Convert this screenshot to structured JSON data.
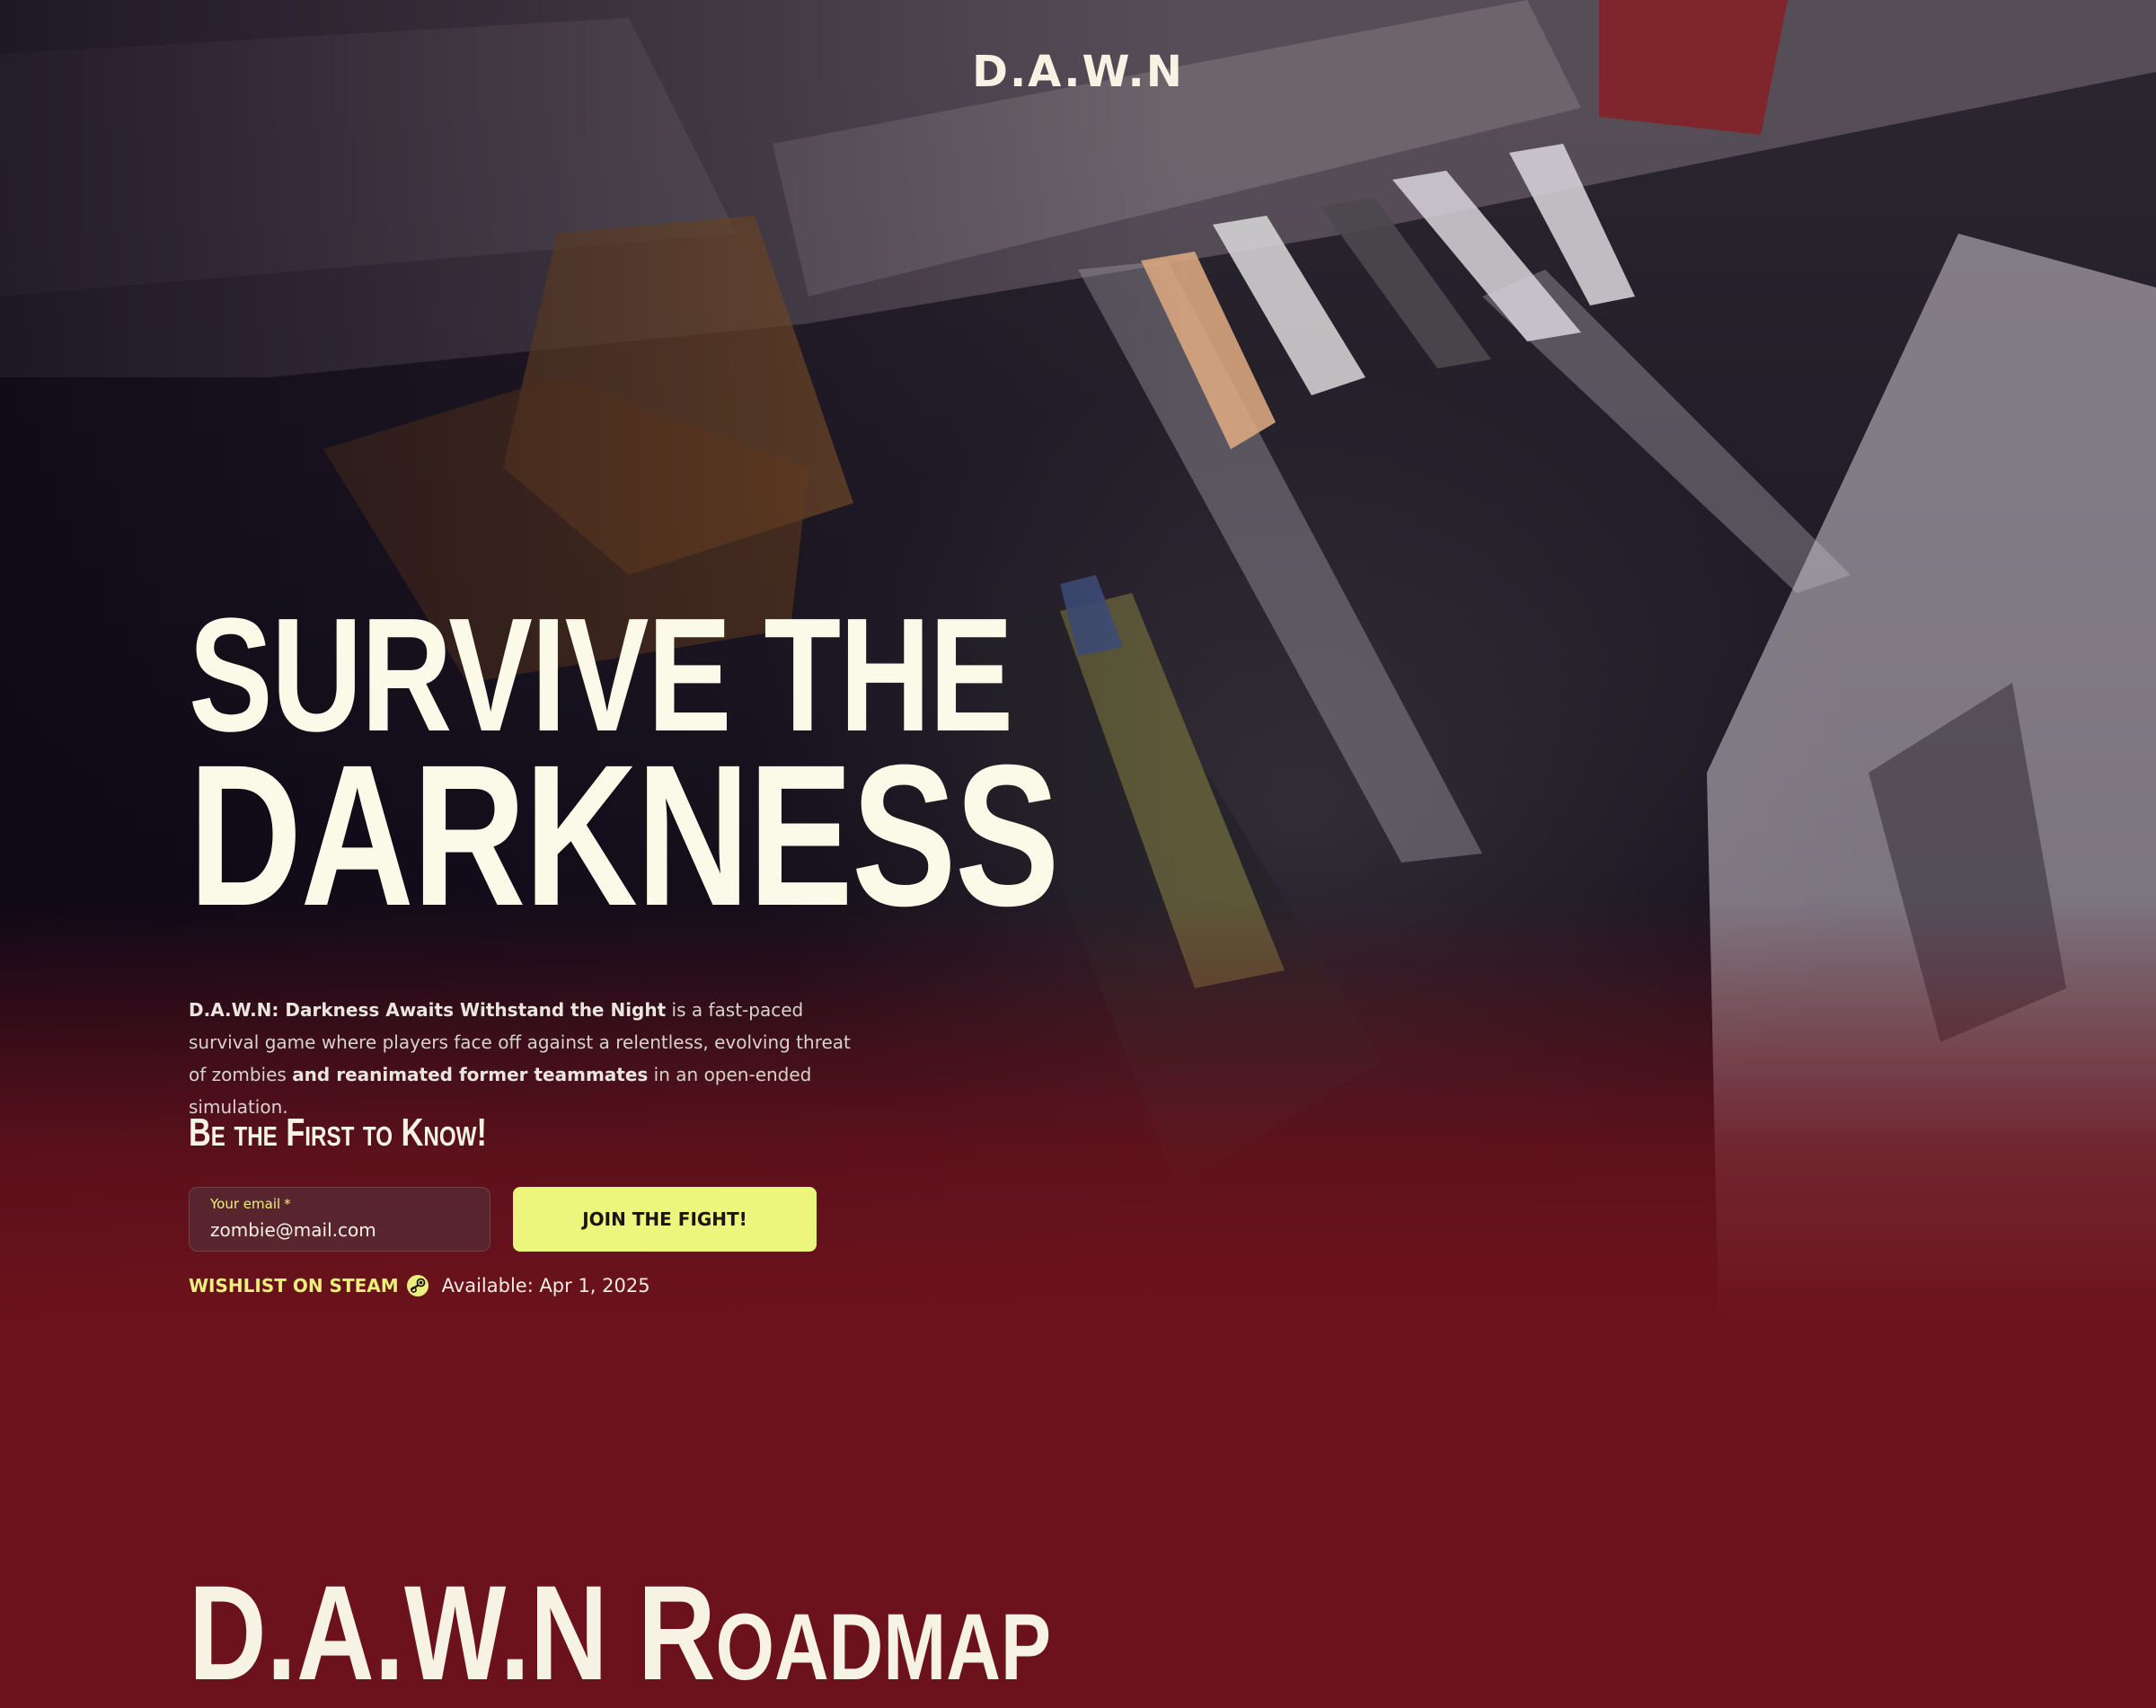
{
  "header": {
    "logo": "D.A.W.N"
  },
  "hero": {
    "title_line1": "SURVIVE THE",
    "title_line2": "DARKNESS",
    "description": {
      "strong1": "D.A.W.N: Darkness Awaits Withstand the Night",
      "text1": " is a fast-paced survival game where players face off against a relentless, evolving threat of zombies ",
      "strong2": "and reanimated former teammates",
      "text2": " in an open-ended simulation."
    }
  },
  "signup": {
    "heading": "Be the First to Know!",
    "email_label": "Your email",
    "email_required_mark": "*",
    "email_value": "zombie@mail.com",
    "button_label": "JOIN THE FIGHT!"
  },
  "steam": {
    "wishlist_label": "WISHLIST ON STEAM",
    "icon": "steam-icon",
    "available_text": "Available: Apr 1, 2025"
  },
  "roadmap": {
    "title": "D.A.W.N Roadmap"
  },
  "colors": {
    "accent": "#ecf57c",
    "background_red": "#6c121c",
    "text_cream": "#fbf9e8"
  }
}
